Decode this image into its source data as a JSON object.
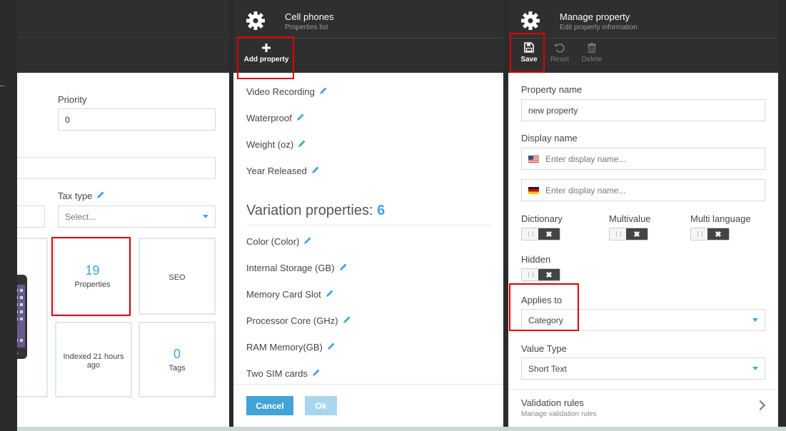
{
  "blade1": {
    "priority_label": "Priority",
    "priority_value": "0",
    "tax_type_label": "Tax type",
    "tax_type_placeholder": "Select...",
    "tiles": [
      {
        "value": "19",
        "label": "Properties"
      },
      {
        "value": "",
        "label": "SEO"
      },
      {
        "value": "",
        "label": "Indexed 21 hours ago"
      },
      {
        "value": "0",
        "label": "Tags"
      }
    ]
  },
  "blade2": {
    "title": "Cell phones",
    "subtitle": "Properties list",
    "add_property_label": "Add property",
    "properties": [
      "Video Recording",
      "Waterproof",
      "Weight (oz)",
      "Year Released"
    ],
    "variation_title": "Variation properties:",
    "variation_count": "6",
    "variation_properties": [
      "Color (Color)",
      "Internal Storage (GB)",
      "Memory Card Slot",
      "Processor Core (GHz)",
      "RAM Memory(GB)",
      "Two SIM cards"
    ],
    "cancel_label": "Cancel",
    "ok_label": "Ok"
  },
  "blade3": {
    "title": "Manage property",
    "subtitle": "Edit property information",
    "save_label": "Save",
    "reset_label": "Reset",
    "delete_label": "Delete",
    "property_name_label": "Property name",
    "property_name_value": "new property",
    "display_name_label": "Display name",
    "display_name_placeholder": "Enter display name...",
    "dictionary_label": "Dictionary",
    "multivalue_label": "Multivalue",
    "multi_language_label": "Multi language",
    "hidden_label": "Hidden",
    "toggle_off_symbol": "✖",
    "applies_to_label": "Applies to",
    "applies_to_value": "Category",
    "value_type_label": "Value Type",
    "value_type_value": "Short Text",
    "validation_rules_title": "Validation rules",
    "validation_rules_subtitle": "Manage validation rules"
  },
  "colors": {
    "accent": "#43a3d8",
    "header_bg": "#2f2f2f",
    "highlight": "#e00000"
  }
}
